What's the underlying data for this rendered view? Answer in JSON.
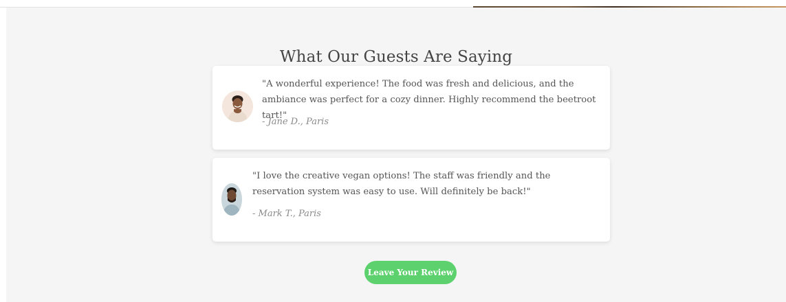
{
  "testimonials": {
    "title": "What Our Guests Are Saying",
    "items": [
      {
        "quote": "\"A wonderful experience! The food was fresh and delicious, and the ambiance was perfect for a cozy dinner. Highly recommend the beetroot tart!\"",
        "author": "- Jane D., Paris",
        "avatar": "woman-portrait-avatar"
      },
      {
        "quote": "\"I love the creative vegan options! The staff was friendly and the reservation system was easy to use. Will definitely be back!\"",
        "author": "- Mark T., Paris",
        "avatar": "man-portrait-avatar"
      }
    ],
    "cta_label": "Leave Your Review"
  },
  "colors": {
    "section_background": "#f5f5f5",
    "card_background": "#ffffff",
    "button": "#5dd16d",
    "title_text": "#444444",
    "body_text": "#555555",
    "author_text": "#8a8a8a"
  }
}
